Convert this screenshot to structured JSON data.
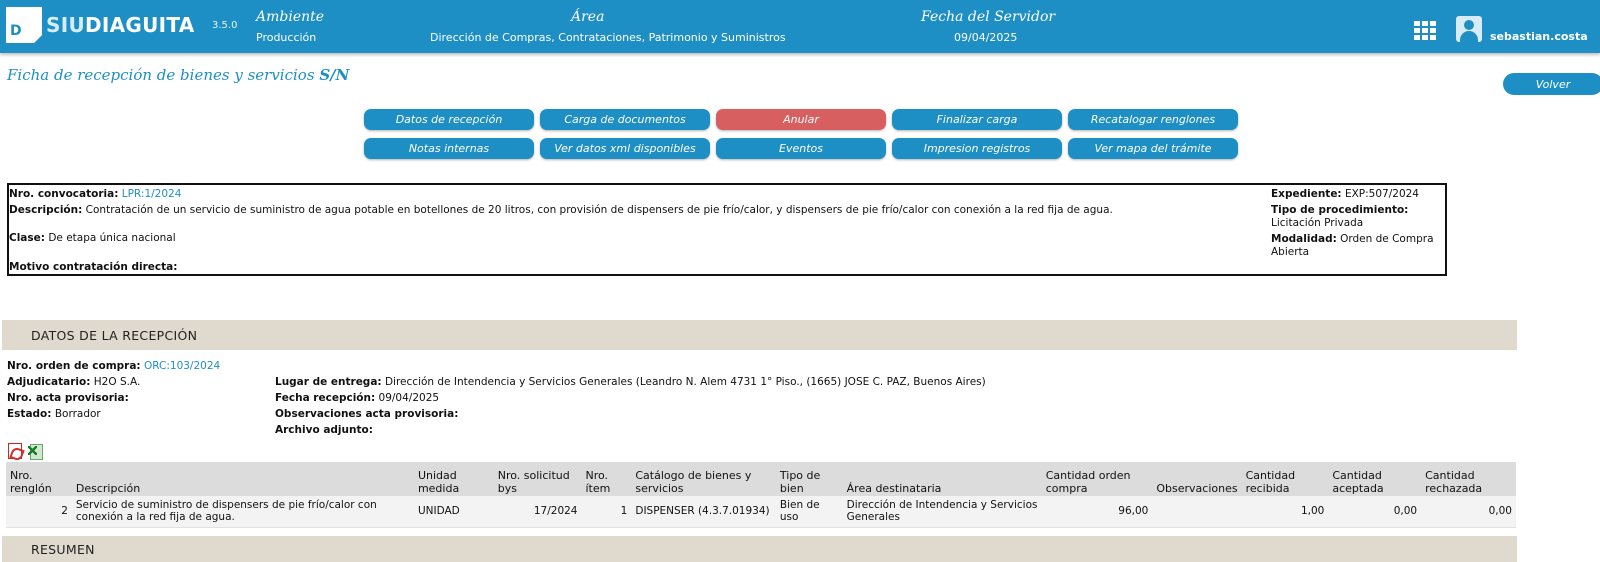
{
  "header": {
    "logo_siu": "SIU",
    "logo_name": "DIAGUITA",
    "logo_letter": "D",
    "version": "3.5.0",
    "ambiente_label": "Ambiente",
    "ambiente_value": "Producción",
    "area_label": "Área",
    "area_value": "Dirección de Compras, Contrataciones, Patrimonio y Suministros",
    "fecha_label": "Fecha del Servidor",
    "fecha_value": "09/04/2025",
    "username": "sebastian.costa",
    "icons": {
      "apps": "apps-grid-icon",
      "user": "user-avatar-icon"
    }
  },
  "page": {
    "title": "Ficha de recepción de bienes y servicios",
    "title_suffix": "S/N",
    "back_label": "Volver"
  },
  "actions": [
    {
      "label": "Datos de recepción",
      "style": "primary"
    },
    {
      "label": "Carga de documentos",
      "style": "primary"
    },
    {
      "label": "Anular",
      "style": "danger"
    },
    {
      "label": "Finalizar carga",
      "style": "primary"
    },
    {
      "label": "Recatalogar renglones",
      "style": "primary"
    },
    {
      "label": "Notas internas",
      "style": "primary"
    },
    {
      "label": "Ver datos xml disponibles",
      "style": "primary"
    },
    {
      "label": "Eventos",
      "style": "primary"
    },
    {
      "label": "Impresion registros",
      "style": "primary"
    },
    {
      "label": "Ver mapa del trámite",
      "style": "primary"
    }
  ],
  "convocatoria": {
    "nro_label": "Nro. convocatoria:",
    "nro_value": "LPR:1/2024",
    "descripcion_label": "Descripción:",
    "descripcion_value": "Contratación de un servicio de suministro de agua potable en botellones de 20 litros, con provisión de dispensers de pie frío/calor, y dispensers de pie frío/calor con conexión a la red fija de agua.",
    "clase_label": "Clase:",
    "clase_value": "De etapa única nacional",
    "motivo_label": "Motivo contratación directa:",
    "motivo_value": "",
    "expediente_label": "Expediente:",
    "expediente_value": "EXP:507/2024",
    "tipo_label": "Tipo de procedimiento:",
    "tipo_value": "Licitación Privada",
    "modalidad_label": "Modalidad:",
    "modalidad_value": "Orden de Compra Abierta"
  },
  "recepcion": {
    "section_title": "DATOS DE LA RECEPCIÓN",
    "orden_label": "Nro. orden de compra:",
    "orden_value": "ORC:103/2024",
    "adjudicatario_label": "Adjudicatario:",
    "adjudicatario_value": "H2O S.A.",
    "acta_label": "Nro. acta provisoria:",
    "acta_value": "",
    "estado_label": "Estado:",
    "estado_value": "Borrador",
    "lugar_label": "Lugar de entrega:",
    "lugar_value": "Dirección de Intendencia y Servicios Generales (Leandro N. Alem 4731 1° Piso., (1665) JOSE C. PAZ, Buenos Aires)",
    "fecha_label": "Fecha recepción:",
    "fecha_value": "09/04/2025",
    "obs_label": "Observaciones acta provisoria:",
    "obs_value": "",
    "archivo_label": "Archivo adjunto:",
    "archivo_value": "",
    "export_icons": [
      "pdf-export-icon",
      "excel-export-icon"
    ]
  },
  "table": {
    "headers": {
      "renglon": "Nro. renglón",
      "descripcion": "Descripción",
      "unidad": "Unidad medida",
      "solicitud": "Nro. solicitud bys",
      "item": "Nro. ítem",
      "catalogo": "Catálogo de bienes y servicios",
      "tipo": "Tipo de bien",
      "area": "Área destinataria",
      "cantidad_orden": "Cantidad orden compra",
      "observaciones": "Observaciones",
      "recibida": "Cantidad recibida",
      "aceptada": "Cantidad aceptada",
      "rechazada": "Cantidad rechazada"
    },
    "rows": [
      {
        "renglon": "2",
        "descripcion": "Servicio de suministro de dispensers de pie frío/calor con conexión a la red fija de agua.",
        "unidad": "UNIDAD",
        "solicitud": "17/2024",
        "item": "1",
        "catalogo": "DISPENSER (4.3.7.01934)",
        "tipo": "Bien de uso",
        "area": "Dirección de Intendencia y Servicios Generales",
        "cantidad_orden": "96,00",
        "observaciones": "",
        "recibida": "1,00",
        "aceptada": "0,00",
        "rechazada": "0,00"
      }
    ]
  },
  "resumen": {
    "section_title": "RESUMEN"
  },
  "colors": {
    "primary": "#1e8fc4",
    "danger": "#d85f5f",
    "section_bg": "#e0d9cd"
  }
}
